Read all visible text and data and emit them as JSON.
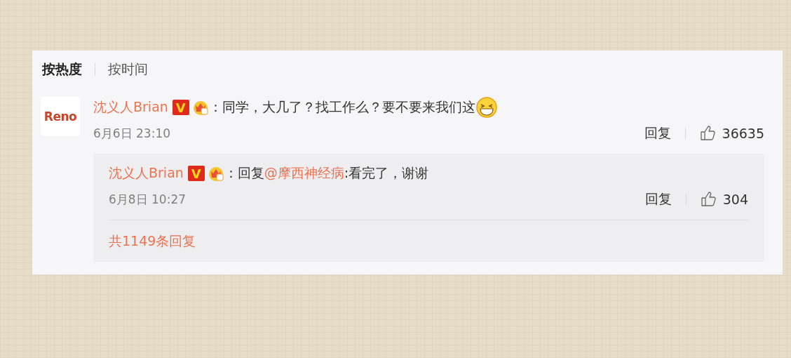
{
  "sort_tabs": [
    {
      "label": "按热度",
      "selected": true
    },
    {
      "label": "按时间",
      "selected": false
    }
  ],
  "comment": {
    "avatar_text": "Reno",
    "author": "沈义人Brian",
    "badge": "V",
    "text": "：同学，大几了？找工作么？要不要来我们这",
    "time": "6月6日 23:10",
    "reply_label": "回复",
    "likes": "36635",
    "reply": {
      "author": "沈义人Brian",
      "badge": "V",
      "prefix": "：回复",
      "mention": "@摩西神经病",
      "text": ":看完了，谢谢",
      "time": "6月8日 10:27",
      "reply_label": "回复",
      "likes": "304"
    },
    "more_replies": "共1149条回复"
  }
}
